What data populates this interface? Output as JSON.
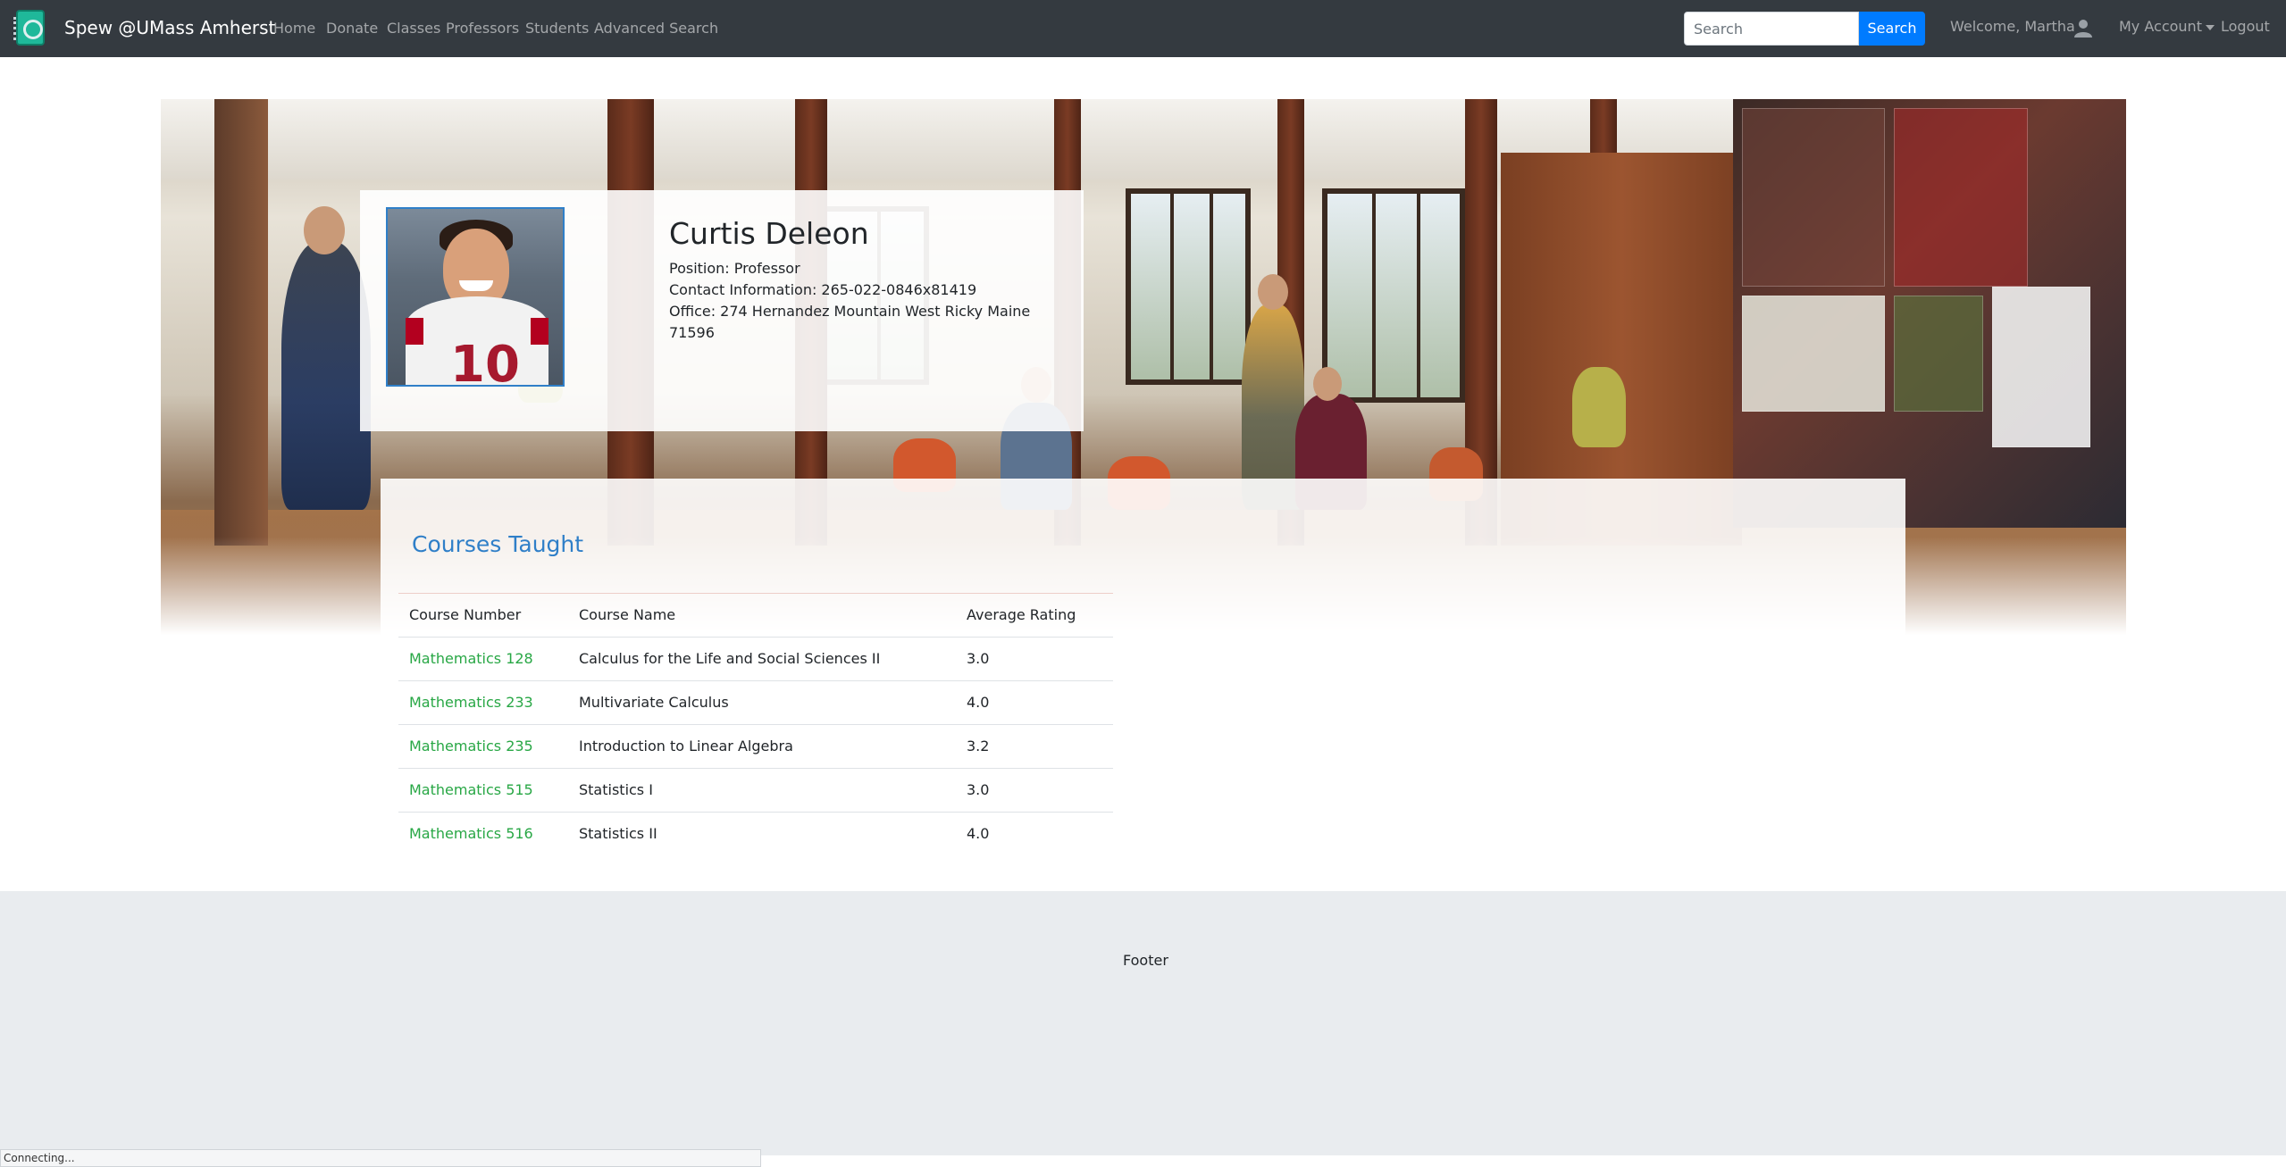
{
  "navbar": {
    "brand": "Spew @UMass Amherst",
    "links": [
      "Home",
      "Donate",
      "Classes",
      "Professors",
      "Students",
      "Advanced Search"
    ],
    "search_placeholder": "Search",
    "search_button": "Search",
    "welcome": "Welcome, Martha",
    "account_menu": "My Account",
    "logout": "Logout"
  },
  "profile": {
    "name": "Curtis Deleon",
    "position": "Position: Professor",
    "contact": "Contact Information: 265-022-0846x81419",
    "office_line1": "Office: 274 Hernandez Mountain West Ricky Maine",
    "office_line2": "71596"
  },
  "courses": {
    "title": "Courses Taught",
    "headers": [
      "Course Number",
      "Course Name",
      "Average Rating"
    ],
    "rows": [
      [
        "Mathematics 128",
        "Calculus for the Life and Social Sciences II",
        "3.0"
      ],
      [
        "Mathematics 233",
        "Multivariate Calculus",
        "4.0"
      ],
      [
        "Mathematics 235",
        "Introduction to Linear Algebra",
        "3.2"
      ],
      [
        "Mathematics 515",
        "Statistics I",
        "3.0"
      ],
      [
        "Mathematics 516",
        "Statistics II",
        "4.0"
      ]
    ]
  },
  "footer": {
    "text": "Footer"
  },
  "status_bar": {
    "text": "Connecting..."
  },
  "colors": {
    "navbar": "#343a40",
    "primary": "#007bff",
    "link_green": "#28a745",
    "heading_blue": "#2f7fc8",
    "footer_bg": "#e9ecef"
  },
  "icons": {
    "user": "user-avatar-icon",
    "logo": "notebook-logo-icon"
  }
}
